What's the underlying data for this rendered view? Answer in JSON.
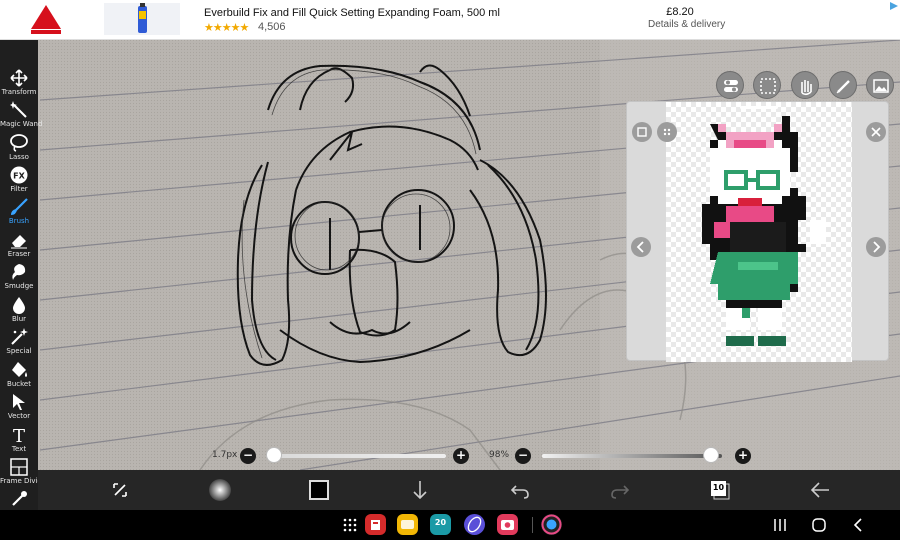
{
  "ad": {
    "brand_icon": "sika-logo",
    "title": "Everbuild Fix and Fill Quick Setting Expanding Foam, 500 ml",
    "stars": "★★★★★",
    "rating_count": "4,506",
    "price": "£8.20",
    "delivery": "Details & delivery"
  },
  "toolbar": {
    "tools": [
      {
        "label": "Transform",
        "icon": "transform-icon"
      },
      {
        "label": "Magic Wand",
        "icon": "magic-wand-icon"
      },
      {
        "label": "Lasso",
        "icon": "lasso-icon"
      },
      {
        "label": "Filter",
        "icon": "filter-icon"
      },
      {
        "label": "Brush",
        "icon": "brush-icon",
        "active": true
      },
      {
        "label": "Eraser",
        "icon": "eraser-icon"
      },
      {
        "label": "Smudge",
        "icon": "smudge-icon"
      },
      {
        "label": "Blur",
        "icon": "blur-icon"
      },
      {
        "label": "Special",
        "icon": "special-icon"
      },
      {
        "label": "Bucket",
        "icon": "bucket-icon"
      },
      {
        "label": "Vector",
        "icon": "vector-icon"
      },
      {
        "label": "Text",
        "icon": "text-icon"
      },
      {
        "label": "Frame Divider",
        "icon": "frame-divider-icon"
      },
      {
        "label": "",
        "icon": "eyedropper-icon"
      }
    ],
    "filter_glyph": "FX",
    "text_glyph": "T"
  },
  "sliders": {
    "size_label": "1.7px",
    "size_value": 0.0,
    "opacity_label": "98%",
    "opacity_value": 0.98,
    "minus": "−",
    "plus": "+"
  },
  "bottombar": {
    "layer_count": "10",
    "icons": [
      "quick-menu-icon",
      "brush-preview-icon",
      "color-swatch",
      "download-icon",
      "undo-icon",
      "redo-icon",
      "layers-icon",
      "back-arrow-icon"
    ]
  },
  "navbar": {
    "calendar_date": "20",
    "apps": [
      "app-drawer-icon",
      "red-app-icon",
      "notes-app-icon",
      "calendar-app-icon",
      "internet-app-icon",
      "camera-app-icon",
      "ibis-paint-app-icon"
    ]
  },
  "colors": {
    "accent": "#39a3ff",
    "toolbar_bg": "#1f1f1f",
    "paper": "#b9b5b0",
    "ralsei_green": "#2e9e6b",
    "ralsei_pink": "#e84a86"
  }
}
